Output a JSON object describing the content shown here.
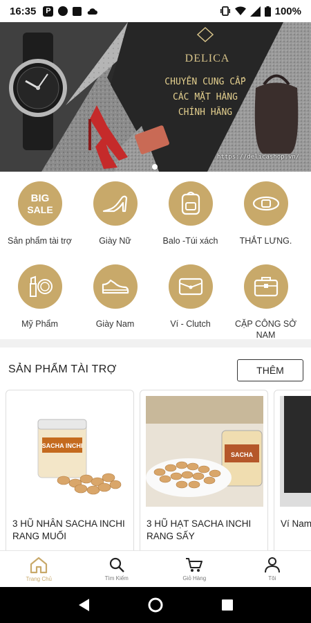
{
  "status_bar": {
    "time": "16:35",
    "battery": "100%"
  },
  "banner": {
    "brand": "DELICA",
    "tagline_1": "CHUYÊN CUNG CẤP",
    "tagline_2": "CÁC MẶT HÀNG",
    "tagline_3": "CHÍNH HÃNG",
    "url": "https://delicashop.vn/"
  },
  "categories": [
    {
      "label": "Sản phẩm tài trợ",
      "icon": "big-sale-icon",
      "badge_1": "BIG",
      "badge_2": "SALE"
    },
    {
      "label": "Giày Nữ",
      "icon": "high-heel-icon"
    },
    {
      "label": "Balo -Túi xách",
      "icon": "backpack-icon"
    },
    {
      "label": "THẮT LƯNG.",
      "icon": "belt-icon"
    },
    {
      "label": "Mỹ Phẩm",
      "icon": "cosmetics-icon"
    },
    {
      "label": "Giày Nam",
      "icon": "sneaker-icon"
    },
    {
      "label": "Ví - Clutch",
      "icon": "wallet-icon"
    },
    {
      "label": "CẶP CÔNG SỞ NAM",
      "icon": "briefcase-icon"
    }
  ],
  "section": {
    "title": "SẢN PHẨM TÀI TRỢ",
    "more_label": "THÊM"
  },
  "products": [
    {
      "name": "3 HŨ NHÂN SACHA INCHI RANG MUỐI",
      "jar_label": "SACHA INCHI"
    },
    {
      "name": "3 HŨ HẠT SACHA INCHI RANG SẤY",
      "jar_label": "SACHA"
    },
    {
      "name": "Ví Nam"
    }
  ],
  "bottom_nav": [
    {
      "label": "Trang Chủ",
      "icon": "home-icon",
      "active": true
    },
    {
      "label": "Tìm Kiếm",
      "icon": "search-icon",
      "active": false
    },
    {
      "label": "Giỏ Hàng",
      "icon": "cart-icon",
      "active": false
    },
    {
      "label": "Tôi",
      "icon": "user-icon",
      "active": false
    }
  ],
  "colors": {
    "accent": "#c8a96a",
    "price": "#e08a1c"
  }
}
